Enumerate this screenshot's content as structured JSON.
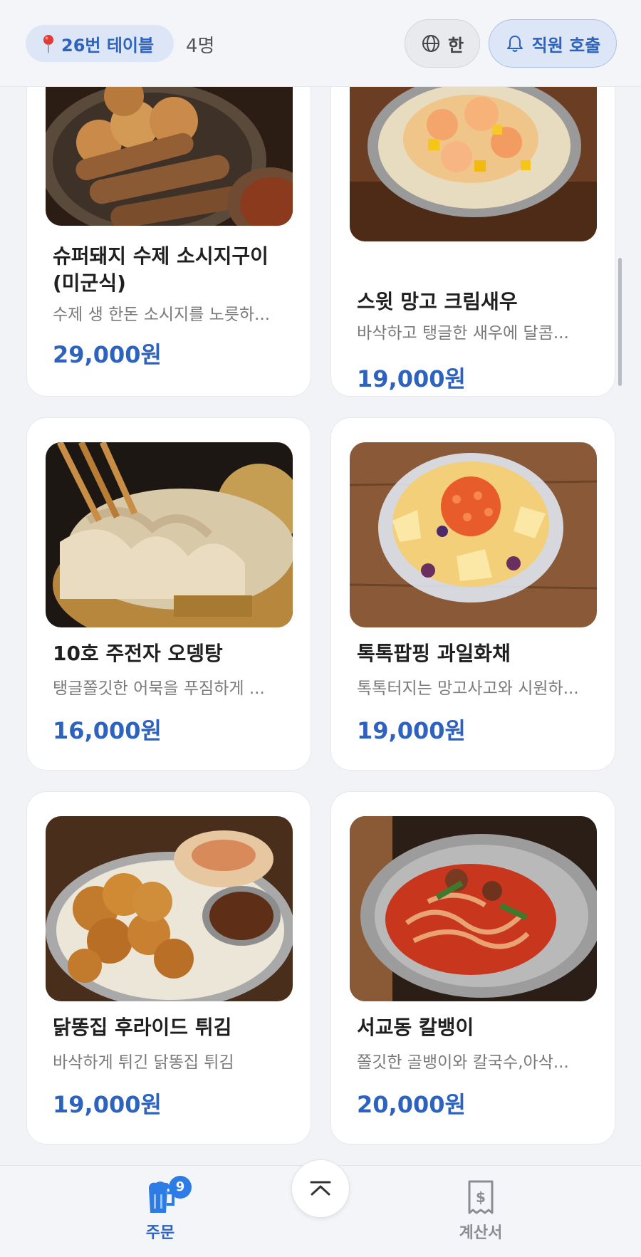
{
  "header": {
    "table_label": "26번 테이블",
    "guest_count": "4명",
    "language_label": "한",
    "call_staff_label": "직원 호출"
  },
  "menu": [
    {
      "name": "슈퍼돼지 수제 소시지구이 (미군식)",
      "description": "수제 생 한돈 소시지를 노릇하...",
      "price": "29,000원"
    },
    {
      "name": "스윗 망고 크림새우",
      "description": "바삭하고 탱글한 새우에 달콤...",
      "price": "19,000원"
    },
    {
      "name": "10호 주전자 오뎅탕",
      "description": "탱글쫄깃한 어묵을 푸짐하게 ...",
      "price": "16,000원"
    },
    {
      "name": "톡톡팝핑 과일화채",
      "description": "톡톡터지는 망고사고와 시원하...",
      "price": "19,000원"
    },
    {
      "name": "닭똥집 후라이드 튀김",
      "description": "바삭하게 튀긴 닭똥집 튀김",
      "price": "19,000원"
    },
    {
      "name": "서교동 칼뱅이",
      "description": "쫄깃한 골뱅이와 칼국수,아삭...",
      "price": "20,000원"
    }
  ],
  "bottom_nav": {
    "order_label": "주문",
    "order_badge": "9",
    "bill_label": "계산서"
  },
  "colors": {
    "accent": "#2d63bf",
    "badge": "#2d7be4",
    "background": "#f2f3f6"
  },
  "icons": [
    "pin-icon",
    "globe-icon",
    "bell-icon",
    "beer-mug-icon",
    "receipt-icon",
    "chevron-up-icon"
  ]
}
